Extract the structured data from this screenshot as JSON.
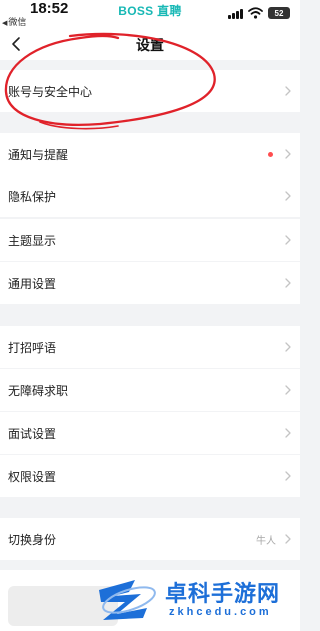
{
  "status_bar": {
    "time": "18:52",
    "back_app": "微信",
    "brand": "BOSS 直聘",
    "battery": "52"
  },
  "nav": {
    "title": "设置"
  },
  "settings": {
    "account_security": "账号与安全中心",
    "notifications": "通知与提醒",
    "privacy": "隐私保护",
    "theme": "主题显示",
    "general": "通用设置",
    "greeting": "打招呼语",
    "accessible_job": "无障碍求职",
    "interview": "面试设置",
    "permissions": "权限设置",
    "switch_identity": "切换身份",
    "switch_identity_value": "牛人"
  },
  "watermark": {
    "title": "卓科手游网",
    "subtitle": "zkhcedu.com"
  },
  "colors": {
    "brand": "#18b8b5",
    "annotation": "#e0222a",
    "notification_dot": "#ff4d4f",
    "watermark": "#1d6fd8"
  }
}
